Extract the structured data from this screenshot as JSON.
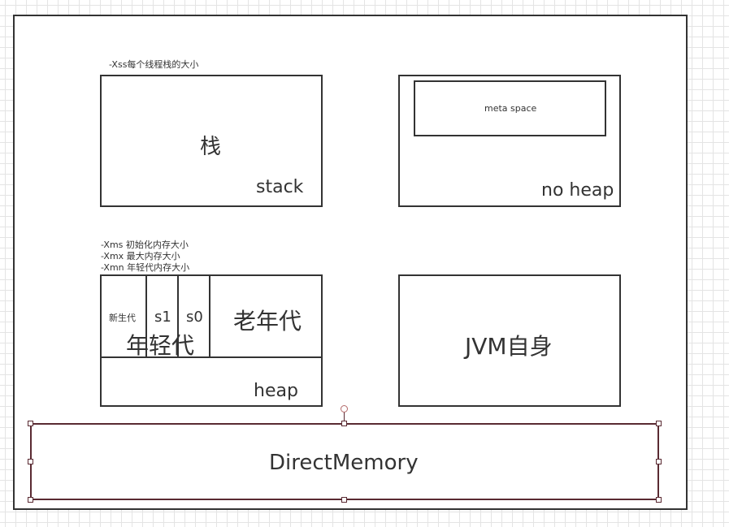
{
  "stack": {
    "note": "-Xss每个线程栈的大小",
    "title": "栈",
    "label": "stack"
  },
  "noheap": {
    "inner": "meta space",
    "label": "no heap"
  },
  "heap": {
    "notes": [
      "-Xms 初始化内存大小",
      "-Xmx 最大内存大小",
      "-Xmn 年轻代内存大小"
    ],
    "eden": "新生代",
    "s1": "s1",
    "s0": "s0",
    "young": "年轻代",
    "old": "老年代",
    "label": "heap"
  },
  "jvm": {
    "label": "JVM自身"
  },
  "direct": {
    "label": "DirectMemory"
  }
}
